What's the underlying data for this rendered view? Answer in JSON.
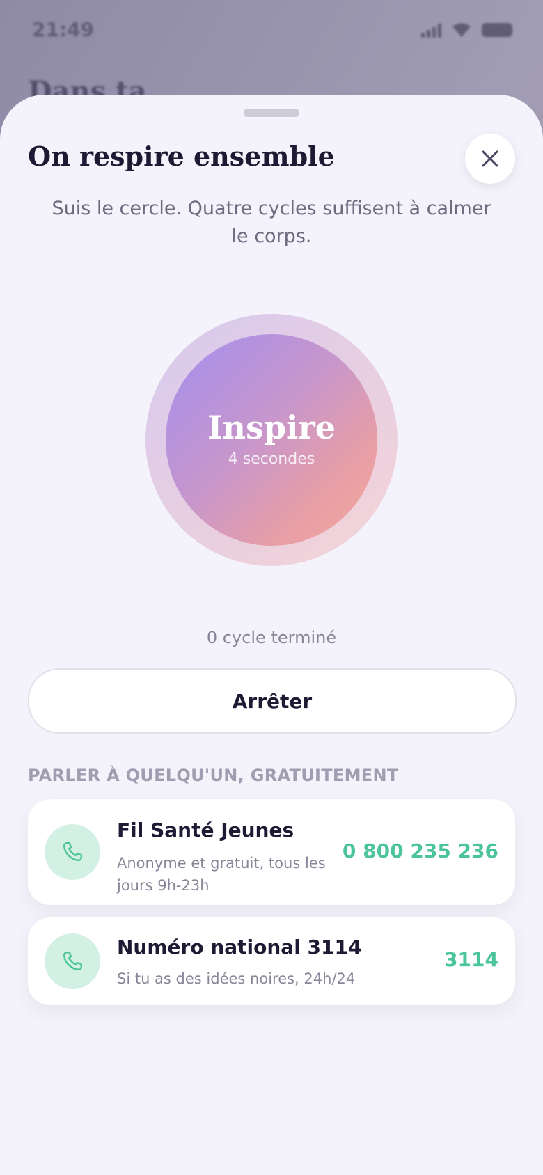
{
  "status_bar": {
    "time": "21:49"
  },
  "background_screen": {
    "title": "Dans ta..."
  },
  "sheet": {
    "title": "On respire ensemble",
    "subtitle": "Suis le cercle. Quatre cycles suffisent à calmer le corps."
  },
  "breathing": {
    "phase": "Inspire",
    "duration": "4 secondes",
    "cycle_status": "0 cycle terminé",
    "stop_label": "Arrêter"
  },
  "help": {
    "section_label": "PARLER À QUELQU'UN, GRATUITEMENT",
    "contacts": [
      {
        "name": "Fil Santé Jeunes",
        "description": "Anonyme et gratuit, tous les jours 9h-23h",
        "number": "0 800 235 236",
        "icon": "phone-icon"
      },
      {
        "name": "Numéro national 3114",
        "description": "Si tu as des idées noires, 24h/24",
        "number": "3114",
        "icon": "phone-icon"
      }
    ]
  },
  "colors": {
    "accent_green": "#4cc49a",
    "text_dark": "#1e1a33",
    "sheet_bg": "#f4f2fa"
  }
}
